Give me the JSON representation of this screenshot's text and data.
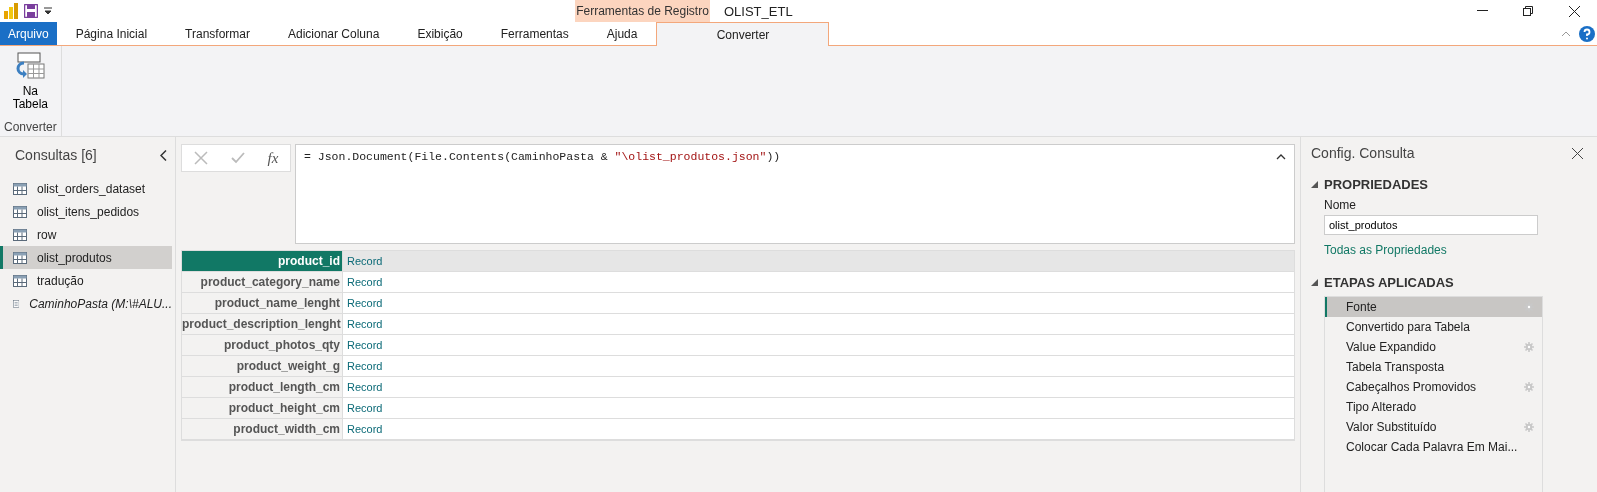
{
  "window": {
    "title": "OLIST_ETL",
    "context_group": "Ferramentas de Registro"
  },
  "tabs": [
    {
      "label": "Arquivo",
      "kind": "file",
      "selected": false
    },
    {
      "label": "Página Inicial",
      "kind": "tab",
      "selected": false
    },
    {
      "label": "Transformar",
      "kind": "tab",
      "selected": false
    },
    {
      "label": "Adicionar Coluna",
      "kind": "tab",
      "selected": false
    },
    {
      "label": "Exibição",
      "kind": "tab",
      "selected": false
    },
    {
      "label": "Ferramentas",
      "kind": "tab",
      "selected": false
    },
    {
      "label": "Ajuda",
      "kind": "tab",
      "selected": false
    },
    {
      "label": "Converter",
      "kind": "context",
      "selected": true
    }
  ],
  "ribbon": {
    "groups": [
      {
        "label": "Converter",
        "buttons": [
          "Na\nTabela"
        ]
      }
    ]
  },
  "queries": {
    "title": "Consultas [6]",
    "items": [
      {
        "label": "olist_orders_dataset",
        "kind": "table",
        "selected": false
      },
      {
        "label": "olist_itens_pedidos",
        "kind": "table",
        "selected": false
      },
      {
        "label": "row",
        "kind": "table",
        "selected": false
      },
      {
        "label": "olist_produtos",
        "kind": "table",
        "selected": true
      },
      {
        "label": "tradução",
        "kind": "table",
        "selected": false
      },
      {
        "label": "CaminhoPasta (M:\\#ALU...",
        "kind": "parameter",
        "selected": false
      }
    ]
  },
  "formula_bar": {
    "fx": "fx",
    "parts": [
      {
        "text": "= Json.Document(File.Contents(CaminhoPasta & ",
        "kind": "code"
      },
      {
        "text": "\"\\olist_produtos.json\"",
        "kind": "string"
      },
      {
        "text": "))",
        "kind": "code"
      }
    ]
  },
  "record": {
    "rows": [
      {
        "field": "product_id",
        "value": "Record",
        "selected": true
      },
      {
        "field": "product_category_name",
        "value": "Record",
        "selected": false
      },
      {
        "field": "product_name_lenght",
        "value": "Record",
        "selected": false
      },
      {
        "field": "product_description_lenght",
        "value": "Record",
        "selected": false
      },
      {
        "field": "product_photos_qty",
        "value": "Record",
        "selected": false
      },
      {
        "field": "product_weight_g",
        "value": "Record",
        "selected": false
      },
      {
        "field": "product_length_cm",
        "value": "Record",
        "selected": false
      },
      {
        "field": "product_height_cm",
        "value": "Record",
        "selected": false
      },
      {
        "field": "product_width_cm",
        "value": "Record",
        "selected": false
      }
    ]
  },
  "settings": {
    "title": "Config. Consulta",
    "properties_heading": "PROPRIEDADES",
    "name_label": "Nome",
    "name_value": "olist_produtos",
    "all_properties_link": "Todas as Propriedades",
    "steps_heading": "ETAPAS APLICADAS",
    "steps": [
      {
        "label": "Fonte",
        "settings": true,
        "selected": true
      },
      {
        "label": "Convertido para Tabela",
        "settings": false,
        "selected": false
      },
      {
        "label": "Value Expandido",
        "settings": true,
        "selected": false
      },
      {
        "label": "Tabela Transposta",
        "settings": false,
        "selected": false
      },
      {
        "label": "Cabeçalhos Promovidos",
        "settings": true,
        "selected": false
      },
      {
        "label": "Tipo Alterado",
        "settings": false,
        "selected": false
      },
      {
        "label": "Valor Substituído",
        "settings": true,
        "selected": false
      },
      {
        "label": "Colocar Cada Palavra Em Mai...",
        "settings": false,
        "selected": false
      }
    ]
  }
}
